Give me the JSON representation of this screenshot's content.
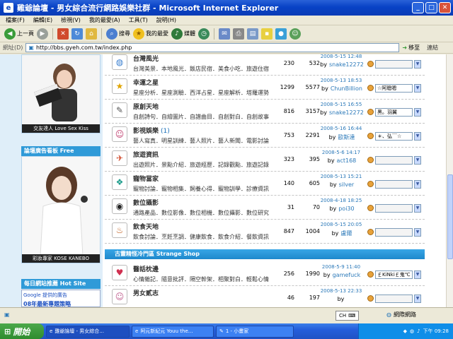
{
  "window": {
    "title": "雞爺論壇 - 男女綜合流行網路娛樂社群 - Microsoft Internet Explorer"
  },
  "menu": [
    "檔案(F)",
    "編輯(E)",
    "檢視(V)",
    "我的最愛(A)",
    "工具(T)",
    "說明(H)"
  ],
  "toolbar": {
    "back_label": "上一頁",
    "search_label": "搜尋",
    "favorites_label": "我的最愛",
    "media_label": "媒體"
  },
  "address": {
    "label": "網址(D)",
    "url": "http://bbs.gyeh.com.tw/index.php",
    "go_label": "移至",
    "links_label": "連結"
  },
  "sidebar": {
    "ad1_caption": "交友達人  Love Sex Kiss",
    "ad2_header": "論壇廣告看板 Free",
    "ad2_caption": "彩妝專家  KOSE KANEBO",
    "hot_header": "每日網站推薦 Hot Site",
    "google_label": "Google 提供的廣告",
    "google_sub": "08年最新專題策略"
  },
  "colors": {
    "accent": "#1e88cc",
    "link": "#2b79b9"
  },
  "forums": [
    {
      "icon": "globe-icon",
      "title": "台灣風光",
      "new_count": "",
      "desc": "台灣美景．本地風光．飯店民宿．美食小吃．旅遊住宿",
      "threads": "230",
      "posts": "532",
      "date": "2008-5-15 12:48",
      "by": "by",
      "user": "snake12272",
      "mod": ""
    },
    {
      "icon": "star-icon",
      "title": "幸運之星",
      "new_count": "",
      "desc": "星座分析．星座測驗．西洋占星．星座解析．塔羅運勢",
      "threads": "1299",
      "posts": "5577",
      "date": "2008-5-13 18:53",
      "by": "by",
      "user": "ChunBillion",
      "mod": "☆阿聰嗯"
    },
    {
      "icon": "notebook-icon",
      "title": "原創天地",
      "new_count": "",
      "desc": "自創詩句．自繪圖片．自譜曲目．自創對白．自創故事",
      "threads": "816",
      "posts": "3157",
      "date": "2008-5-15 16:55",
      "by": "by",
      "user": "snake12272",
      "mod": "黑。羽翼"
    },
    {
      "icon": "star-portrait-icon",
      "title": "影視娛樂",
      "new_count": "(1)",
      "desc": "藝人寫真．明星訓練．藝人照片．藝人新聞．電影討論",
      "threads": "753",
      "posts": "2291",
      "date": "2008-5-16 16:44",
      "by": "by",
      "user": "歐斯達",
      "mod": "＊、弘￣☆"
    },
    {
      "icon": "travel-icon",
      "title": "旅遊資訊",
      "new_count": "",
      "desc": "出遊照片．景點介紹．旅遊經歷．記錄觀點．旅遊記錄",
      "threads": "323",
      "posts": "395",
      "date": "2008-5-6 14:17",
      "by": "by",
      "user": "act168",
      "mod": ""
    },
    {
      "icon": "paw-icon",
      "title": "寵物當家",
      "new_count": "",
      "desc": "寵物討論．寵物相集．飼養心得．寵物訓學．診療資訊",
      "threads": "140",
      "posts": "605",
      "date": "2008-5-13 15:21",
      "by": "by",
      "user": "silver",
      "mod": ""
    },
    {
      "icon": "camera-icon",
      "title": "數位攝影",
      "new_count": "",
      "desc": "通路產品．數位影像．數位相機．數位攝影．數位研究",
      "threads": "31",
      "posts": "70",
      "date": "2008-4-18 18:25",
      "by": "by",
      "user": "poi30",
      "mod": ""
    },
    {
      "icon": "food-icon",
      "title": "飲食天地",
      "new_count": "",
      "desc": "飲食討論．烹飪烹調．健康飲食．飲食介紹．餐飲資訊",
      "threads": "847",
      "posts": "1004",
      "date": "2008-5-15 20:05",
      "by": "by",
      "user": "盧爾",
      "mod": ""
    }
  ],
  "category2": {
    "header": "古靈精怪冷門區 Strange Shop",
    "forums": [
      {
        "icon": "heart-icon",
        "title": "醫話枕邊",
        "new_count": "",
        "desc": "心情雜記．隨意批評．隔空幹架．相聚對白．輕鬆心情",
        "threads": "256",
        "posts": "1990",
        "date": "2008-5-9 11:40",
        "by": "by",
        "user": "gamefuck",
        "mod": "￡KiNki￡鬼℃"
      },
      {
        "icon": "girl-portrait-icon",
        "title": "男女貳志",
        "new_count": "",
        "desc": "",
        "threads": "46",
        "posts": "197",
        "date": "2008-5-13 22:33",
        "by": "by",
        "user": "",
        "mod": ""
      }
    ]
  },
  "status": {
    "lang": "CH",
    "zone": "網際網路"
  },
  "taskbar": {
    "start": "開始",
    "tasks": [
      "雞爺論壇 - 男女綜合...",
      "阿元新紀元 Youu the...",
      "1 - 小畫家"
    ],
    "clock": "下午 09:28"
  }
}
